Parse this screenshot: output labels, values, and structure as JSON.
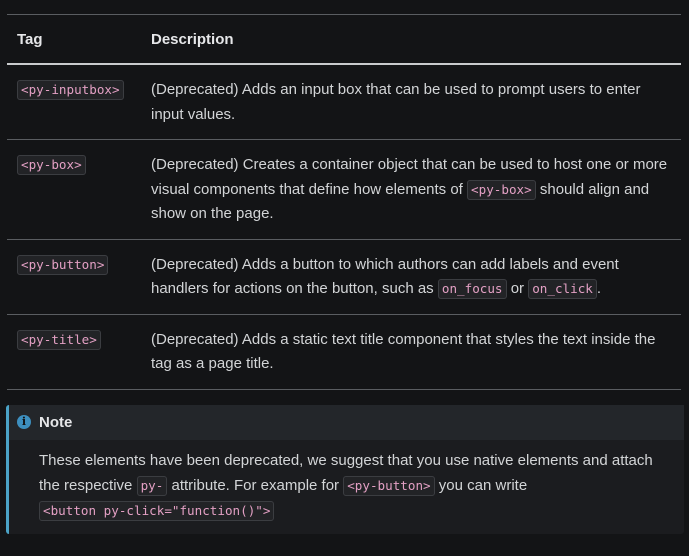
{
  "table": {
    "headers": {
      "tag": "Tag",
      "description": "Description"
    },
    "rows": [
      {
        "tag": "<py-inputbox>",
        "desc_before": "(Deprecated) Adds an input box that can be used to prompt users to enter input values."
      },
      {
        "tag": "<py-box>",
        "desc_before": "(Deprecated) Creates a container object that can be used to host one or more visual components that define how elements of ",
        "desc_code1": "<py-box>",
        "desc_after": " should align and show on the page."
      },
      {
        "tag": "<py-button>",
        "desc_before": "(Deprecated) Adds a button to which authors can add labels and event handlers for actions on the button, such as ",
        "desc_code1": "on_focus",
        "desc_mid": " or ",
        "desc_code2": "on_click",
        "desc_after": "."
      },
      {
        "tag": "<py-title>",
        "desc_before": "(Deprecated) Adds a static text title component that styles the text inside the tag as a page title."
      }
    ]
  },
  "note": {
    "icon": "info-icon",
    "icon_glyph": "i",
    "title": "Note",
    "text1": "These elements have been deprecated, we suggest that you use native elements and attach the respective ",
    "code1": "py-",
    "text2": " attribute. For example for ",
    "code2": "<py-button>",
    "text3": " you can write ",
    "code3": "<button py-click=\"function()\">"
  },
  "colors": {
    "background": "#131416",
    "code_text": "#e3a0c4",
    "note_accent": "#4ba3c7"
  }
}
